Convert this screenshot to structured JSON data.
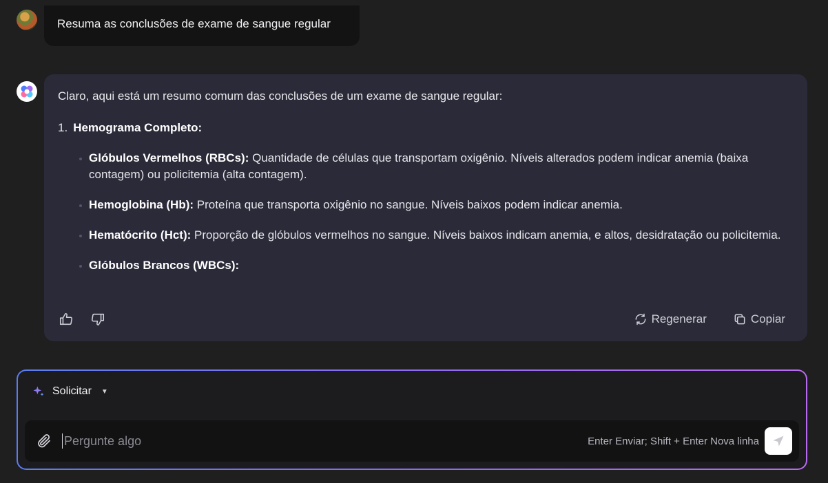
{
  "user_message": {
    "text": "Resuma as conclusões de exame de sangue regular"
  },
  "assistant_message": {
    "intro": "Claro, aqui está um resumo comum das conclusões de um exame de sangue regular:",
    "section": {
      "number": "1.",
      "title": "Hemograma Completo:"
    },
    "items": [
      {
        "term": "Glóbulos Vermelhos (RBCs):",
        "text": " Quantidade de células que transportam oxigênio. Níveis alterados podem indicar anemia (baixa contagem) ou policitemia (alta contagem)."
      },
      {
        "term": "Hemoglobina (Hb):",
        "text": " Proteína que transporta oxigênio no sangue. Níveis baixos podem indicar anemia."
      },
      {
        "term": "Hematócrito (Hct):",
        "text": " Proporção de glóbulos vermelhos no sangue. Níveis baixos indicam anemia, e altos, desidratação ou policitemia."
      },
      {
        "term": "Glóbulos Brancos (WBCs):",
        "text": ""
      }
    ],
    "actions": {
      "regenerate": "Regenerar",
      "copy": "Copiar"
    }
  },
  "composer": {
    "mode_label": "Solicitar",
    "placeholder": "Pergunte algo",
    "hint": "Enter Enviar; Shift + Enter Nova linha"
  },
  "icons": {
    "user_avatar": "avatar",
    "bot_avatar": "assistant-logo-icon",
    "like": "thumbs-up-icon",
    "dislike": "thumbs-down-icon",
    "regenerate": "refresh-icon",
    "copy": "copy-icon",
    "sparkle": "sparkle-icon",
    "attach": "paperclip-icon",
    "send": "send-icon"
  },
  "colors": {
    "accent_start": "#5b7df0",
    "accent_end": "#b86bf0",
    "card_bg": "#2b2a39"
  }
}
